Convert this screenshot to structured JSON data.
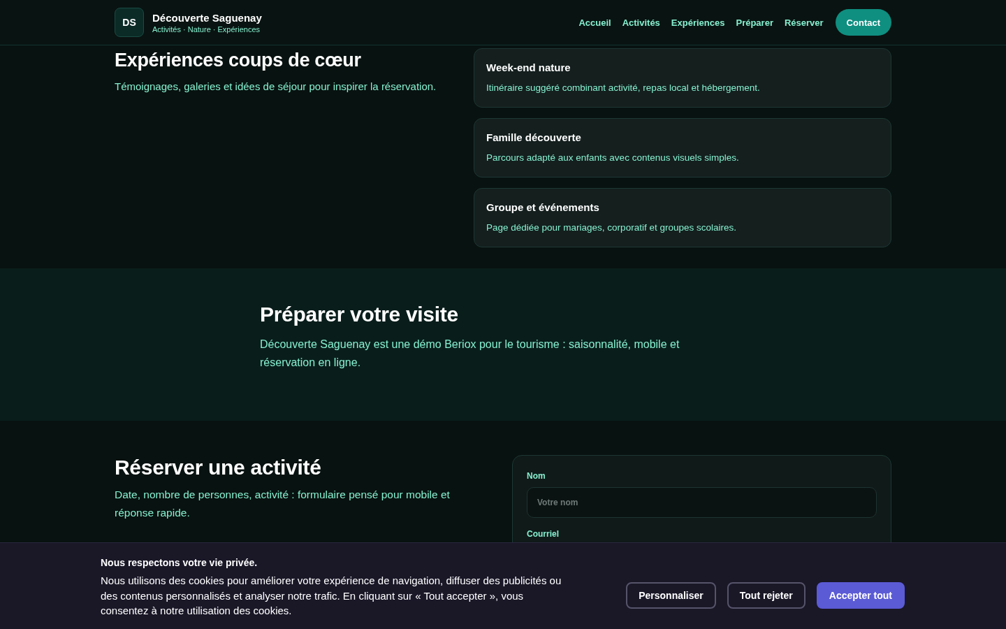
{
  "header": {
    "logo": "DS",
    "brand": "Découverte Saguenay",
    "tagline": "Activités · Nature · Expériences",
    "nav": [
      {
        "label": "Accueil"
      },
      {
        "label": "Activités"
      },
      {
        "label": "Expériences"
      },
      {
        "label": "Préparer"
      },
      {
        "label": "Réserver"
      }
    ],
    "cta": "Contact"
  },
  "highlights": {
    "title": "Expériences coups de cœur",
    "subtitle": "Témoignages, galeries et idées de séjour pour inspirer la réservation.",
    "cards": [
      {
        "title": "Week-end nature",
        "text": "Itinéraire suggéré combinant activité, repas local et hébergement."
      },
      {
        "title": "Famille découverte",
        "text": "Parcours adapté aux enfants avec contenus visuels simples."
      },
      {
        "title": "Groupe et événements",
        "text": "Page dédiée pour mariages, corporatif et groupes scolaires."
      }
    ]
  },
  "prepare": {
    "title": "Préparer votre visite",
    "text": "Découverte Saguenay est une démo Beriox pour le tourisme : saisonnalité, mobile et réservation en ligne."
  },
  "booking": {
    "title": "Réserver une activité",
    "text": "Date, nombre de personnes, activité : formulaire pensé pour mobile et réponse rapide.",
    "fields": [
      {
        "label": "Nom",
        "placeholder": "Votre nom"
      },
      {
        "label": "Courriel"
      }
    ]
  },
  "cookie_banner": {
    "title": "Nous respectons votre vie privée.",
    "text": "Nous utilisons des cookies pour améliorer votre expérience de navigation, diffuser des publicités ou des contenus personnalisés et analyser notre trafic. En cliquant sur « Tout accepter », vous consentez à notre utilisation des cookies.",
    "buttons": [
      {
        "label": "Personnaliser",
        "kind": "outline"
      },
      {
        "label": "Tout rejeter",
        "kind": "outline"
      },
      {
        "label": "Accepter tout",
        "kind": "primary"
      }
    ]
  }
}
